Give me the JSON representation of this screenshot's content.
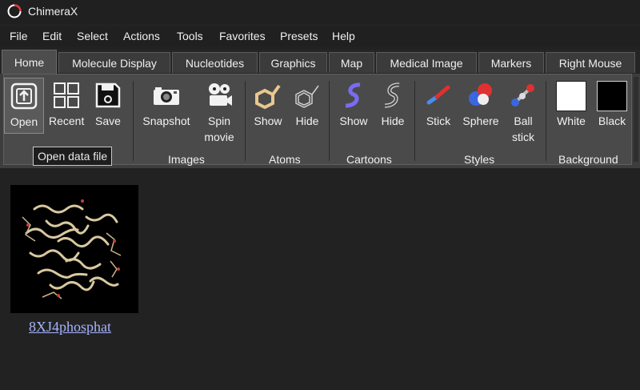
{
  "window": {
    "title": "ChimeraX",
    "icon": "chimerax-logo-icon"
  },
  "menu": [
    "File",
    "Edit",
    "Select",
    "Actions",
    "Tools",
    "Favorites",
    "Presets",
    "Help"
  ],
  "tabs": [
    "Home",
    "Molecule Display",
    "Nucleotides",
    "Graphics",
    "Map",
    "Medical Image",
    "Markers",
    "Right Mouse"
  ],
  "active_tab": "Home",
  "toolbar": {
    "file": {
      "open": "Open",
      "recent": "Recent",
      "save": "Save"
    },
    "images": {
      "snapshot": "Snapshot",
      "spin_movie": [
        "Spin",
        "movie"
      ],
      "label": "Images"
    },
    "atoms": {
      "show": "Show",
      "hide": "Hide",
      "label": "Atoms"
    },
    "cartoons": {
      "show": "Show",
      "hide": "Hide",
      "label": "Cartoons"
    },
    "styles": {
      "stick": "Stick",
      "sphere": "Sphere",
      "ball_stick": [
        "Ball",
        "stick"
      ],
      "label": "Styles"
    },
    "background": {
      "white": "White",
      "black": "Black",
      "label": "Background"
    }
  },
  "tooltip": "Open data file",
  "recent_files": [
    {
      "name": "8XJ4phosphat",
      "thumbnail": "protein-structure-thumbnail"
    }
  ],
  "colors": {
    "background": "#222222",
    "ribbon": "#4a4a4a",
    "link": "#a6b4ff",
    "atom_icon": "#e8c890",
    "cartoon_icon": "#7a6cf0"
  }
}
